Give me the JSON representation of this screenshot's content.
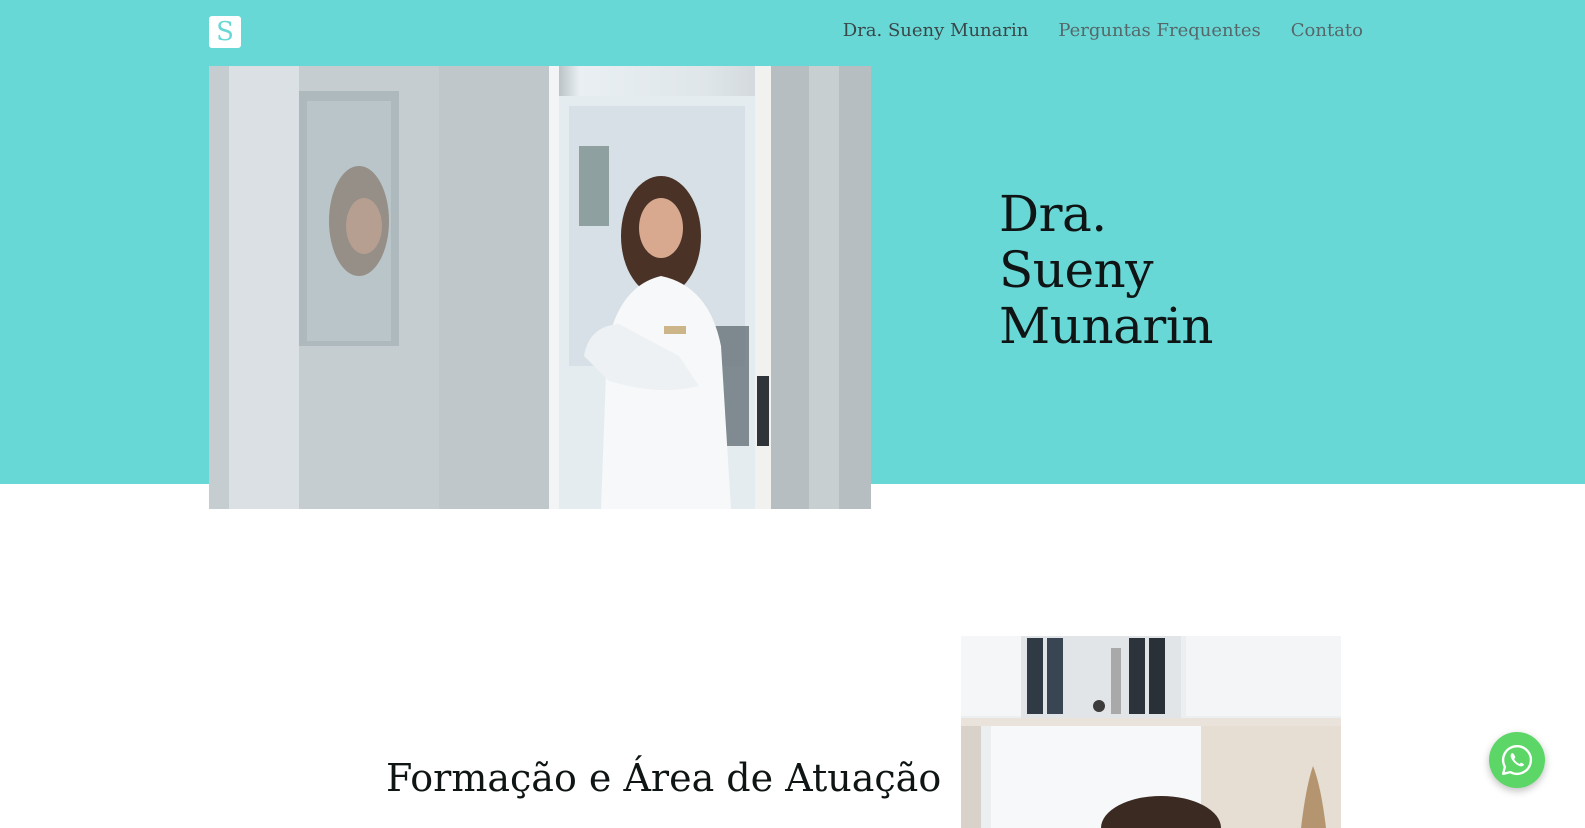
{
  "header": {
    "logo_letter": "S",
    "nav": [
      {
        "label": "Dra. Sueny Munarin",
        "active": true
      },
      {
        "label": "Perguntas Frequentes",
        "active": false
      },
      {
        "label": "Contato",
        "active": false
      }
    ]
  },
  "hero": {
    "title_line1": "Dra.",
    "title_line2": "Sueny",
    "title_line3": "Munarin",
    "band_color": "#68d8d6"
  },
  "section": {
    "title": "Formação e Área de Atuação"
  },
  "floating": {
    "whatsapp_icon": "whatsapp-icon",
    "color": "#5cd667"
  }
}
